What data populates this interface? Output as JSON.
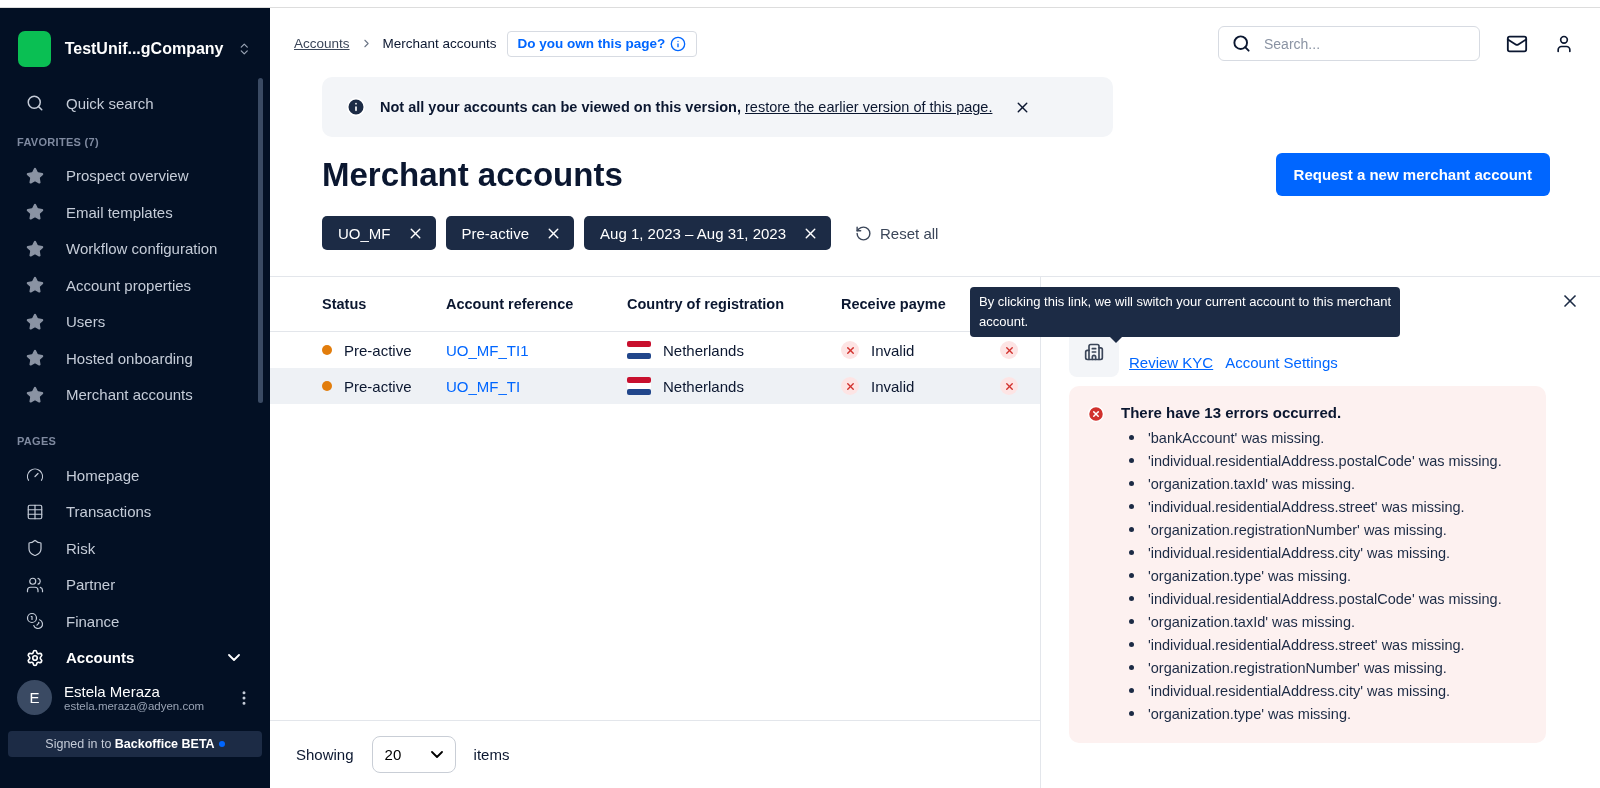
{
  "sidebar": {
    "org": "TestUnif...gCompany",
    "quick_search": "Quick search",
    "favorites_heading": "FAVORITES (7)",
    "favorites": [
      {
        "label": "Prospect overview"
      },
      {
        "label": "Email templates"
      },
      {
        "label": "Workflow configuration"
      },
      {
        "label": "Account properties"
      },
      {
        "label": "Users"
      },
      {
        "label": "Hosted onboarding"
      },
      {
        "label": "Merchant accounts"
      }
    ],
    "pages_heading": "PAGES",
    "pages": [
      {
        "label": "Homepage",
        "selected": false
      },
      {
        "label": "Transactions",
        "selected": false
      },
      {
        "label": "Risk",
        "selected": false
      },
      {
        "label": "Partner",
        "selected": false
      },
      {
        "label": "Finance",
        "selected": false
      },
      {
        "label": "Accounts",
        "selected": true,
        "expanded": true
      }
    ],
    "user": {
      "initial": "E",
      "name": "Estela Meraza",
      "email": "estela.meraza@adyen.com"
    },
    "signed_in": "Signed in to **Backoffice BETA**"
  },
  "header": {
    "breadcrumb": [
      {
        "label": "Accounts",
        "kind": "link"
      },
      {
        "label": "Merchant accounts",
        "kind": "current"
      }
    ],
    "ownership_button": "Do you own this page?",
    "search": {
      "placeholder": "Search..."
    }
  },
  "banner": {
    "text": "Not all your accounts can be viewed on this version,",
    "link": "restore the earlier version of this page."
  },
  "title": "Merchant accounts",
  "request_button": "Request a new merchant account",
  "filters": [
    "UO_MF",
    "Pre-active",
    "Aug 1, 2023 – Aug 31, 2023"
  ],
  "reset": "Reset all",
  "table": {
    "columns": [
      "Status",
      "Account reference",
      "Country of registration",
      "Receive payme"
    ],
    "rows": [
      {
        "status": "Pre-active",
        "color": "#e27d0c",
        "reference": "UO_MF_TI1",
        "country": "Netherlands",
        "receive": "Invalid",
        "selected": false
      },
      {
        "status": "Pre-active",
        "color": "#e27d0c",
        "reference": "UO_MF_TI",
        "country": "Netherlands",
        "receive": "Invalid",
        "selected": true
      }
    ]
  },
  "footer": {
    "showing": "Showing",
    "page_size": "20",
    "items": "items"
  },
  "tooltip": "By clicking this link, we will switch your current account to this merchant account.",
  "panel": {
    "links": [
      "Review KYC",
      "Account Settings"
    ],
    "error_title": "There have 13 errors occurred.",
    "errors": [
      "'bankAccount' was missing.",
      "'individual.residentialAddress.postalCode' was missing.",
      "'organization.taxId' was missing.",
      "'individual.residentialAddress.street' was missing.",
      "'organization.registrationNumber' was missing.",
      "'individual.residentialAddress.city' was missing.",
      "'organization.type' was missing.",
      "'individual.residentialAddress.postalCode' was missing.",
      "'organization.taxId' was missing.",
      "'individual.residentialAddress.street' was missing.",
      "'organization.registrationNumber' was missing.",
      "'individual.residentialAddress.city' was missing.",
      "'organization.type' was missing."
    ]
  }
}
